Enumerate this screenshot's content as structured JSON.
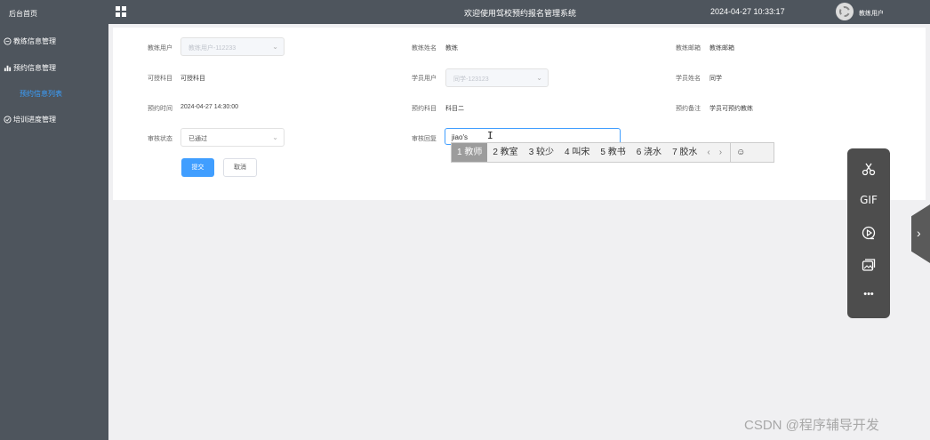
{
  "sidebar": {
    "title": "后台首页",
    "items": [
      {
        "label": "教练信息管理",
        "icon": "chat-bubble-icon"
      },
      {
        "label": "预约信息管理",
        "icon": "bar-chart-icon"
      },
      {
        "label": "培训进度管理",
        "icon": "check-circle-icon"
      }
    ],
    "active_sub": "预约信息列表"
  },
  "header": {
    "title": "欢迎使用驾校预约报名管理系统",
    "datetime": "2024-04-27 10:33:17",
    "user": "教练用户"
  },
  "form": {
    "coach_user_label": "教练用户",
    "coach_user_value": "教练用户-112233",
    "coach_name_label": "教练姓名",
    "coach_name_value": "教练",
    "coach_mailbox_label": "教练邮箱",
    "coach_mailbox_value": "教练邮箱",
    "subject_label": "可授科目",
    "subject_value": "可授科目",
    "student_user_label": "学员用户",
    "student_user_value": "同学-123123",
    "student_name_label": "学员姓名",
    "student_name_value": "同学",
    "time_label": "预约时间",
    "time_value": "2024-04-27 14:30:00",
    "book_subject_label": "预约科目",
    "book_subject_value": "科目二",
    "note_label": "预约备注",
    "note_value": "学员可预约教练",
    "status_label": "审核状态",
    "status_value": "已通过",
    "reply_label": "审核回复",
    "reply_value": "jiao's",
    "submit_label": "提交",
    "cancel_label": "取消"
  },
  "ime": {
    "candidates": [
      "1 教师",
      "2 教室",
      "3 较少",
      "4 叫宋",
      "5 教书",
      "6 浇水",
      "7 胶水"
    ],
    "prev": "‹",
    "next": "›",
    "emoji": "☺"
  },
  "toolbar": {
    "gif_label": "GIF",
    "more_label": "•••"
  },
  "watermark": "CSDN @程序辅导开发"
}
